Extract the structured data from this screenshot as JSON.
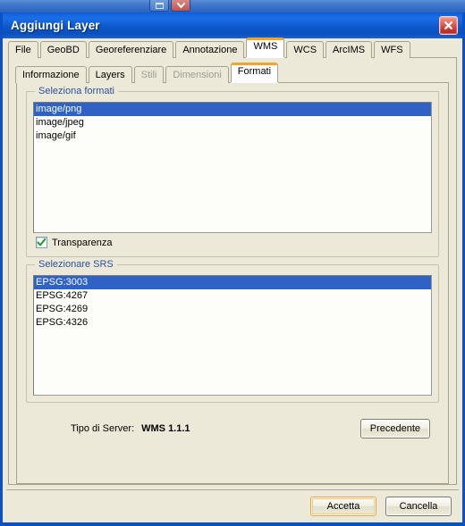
{
  "parent_window": {
    "minimize_label": "Minimize",
    "close_label": "Close"
  },
  "dialog": {
    "title": "Aggiungi Layer",
    "close_label": "Chiudi"
  },
  "outer_tabs": [
    {
      "label": "File",
      "active": false,
      "disabled": false
    },
    {
      "label": "GeoBD",
      "active": false,
      "disabled": false
    },
    {
      "label": "Georeferenziare",
      "active": false,
      "disabled": false
    },
    {
      "label": "Annotazione",
      "active": false,
      "disabled": false
    },
    {
      "label": "WMS",
      "active": true,
      "disabled": false
    },
    {
      "label": "WCS",
      "active": false,
      "disabled": false
    },
    {
      "label": "ArcIMS",
      "active": false,
      "disabled": false
    },
    {
      "label": "WFS",
      "active": false,
      "disabled": false
    }
  ],
  "inner_tabs": [
    {
      "label": "Informazione",
      "active": false,
      "disabled": false
    },
    {
      "label": "Layers",
      "active": false,
      "disabled": false
    },
    {
      "label": "Stili",
      "active": false,
      "disabled": true
    },
    {
      "label": "Dimensioni",
      "active": false,
      "disabled": true
    },
    {
      "label": "Formati",
      "active": true,
      "disabled": false
    }
  ],
  "formats_group": {
    "legend": "Seleziona formati",
    "items": [
      {
        "label": "image/png",
        "selected": true
      },
      {
        "label": "image/jpeg",
        "selected": false
      },
      {
        "label": "image/gif",
        "selected": false
      }
    ],
    "transparency": {
      "label": "Transparenza",
      "checked": true
    }
  },
  "srs_group": {
    "legend": "Selezionare SRS",
    "items": [
      {
        "label": "EPSG:3003",
        "selected": true
      },
      {
        "label": "EPSG:4267",
        "selected": false
      },
      {
        "label": "EPSG:4269",
        "selected": false
      },
      {
        "label": "EPSG:4326",
        "selected": false
      }
    ]
  },
  "server_info": {
    "label": "Tipo di Server:",
    "value": "WMS 1.1.1"
  },
  "buttons": {
    "previous": "Precedente",
    "accept": "Accetta",
    "cancel": "Cancella"
  },
  "colors": {
    "titlebar_blue": "#0d58cc",
    "dialog_border": "#0a51c6",
    "face": "#ece9d8",
    "selection_blue": "#2f62c4",
    "legend_blue": "#2b4f9e",
    "active_tab_accent": "#f0a42b",
    "check_green": "#1f9a2e",
    "close_red": "#c8352c"
  }
}
